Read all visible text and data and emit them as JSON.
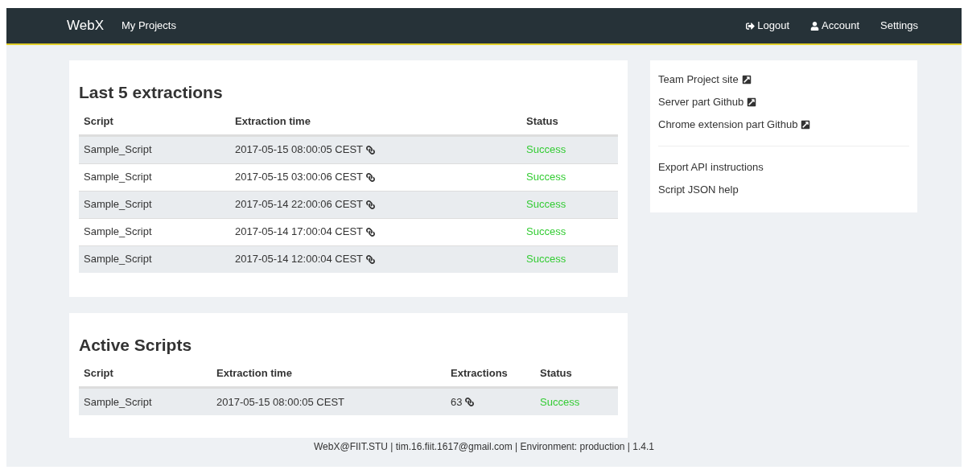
{
  "navbar": {
    "brand": "WebX",
    "left_links": [
      "My Projects"
    ],
    "right_links": [
      {
        "label": "Logout",
        "kind": "logout"
      },
      {
        "label": "Account",
        "kind": "account"
      },
      {
        "label": "Settings",
        "kind": "text"
      }
    ]
  },
  "extractions": {
    "title": "Last 5 extractions",
    "columns": [
      "Script",
      "Extraction time",
      "Status"
    ],
    "rows": [
      {
        "script": "Sample_Script",
        "time": "2017-05-15 08:00:05 CEST",
        "status": "Success"
      },
      {
        "script": "Sample_Script",
        "time": "2017-05-15 03:00:06 CEST",
        "status": "Success"
      },
      {
        "script": "Sample_Script",
        "time": "2017-05-14 22:00:06 CEST",
        "status": "Success"
      },
      {
        "script": "Sample_Script",
        "time": "2017-05-14 17:00:04 CEST",
        "status": "Success"
      },
      {
        "script": "Sample_Script",
        "time": "2017-05-14 12:00:04 CEST",
        "status": "Success"
      }
    ]
  },
  "active_scripts": {
    "title": "Active Scripts",
    "columns": [
      "Script",
      "Extraction time",
      "Extractions",
      "Status"
    ],
    "rows": [
      {
        "script": "Sample_Script",
        "time": "2017-05-15 08:00:05 CEST",
        "extractions": "63",
        "status": "Success"
      }
    ]
  },
  "sidebar": {
    "external_links": [
      "Team Project site",
      "Server part Github",
      "Chrome extension part Github"
    ],
    "links": [
      "Export API instructions",
      "Script JSON help"
    ]
  },
  "footer": "WebX@FIIT.STU | tim.16.fiit.1617@gmail.com | Environment: production | 1.4.1"
}
